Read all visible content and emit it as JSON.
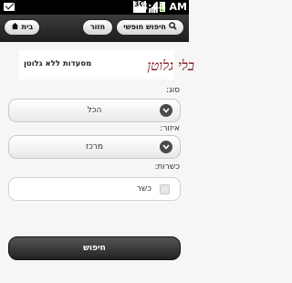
{
  "status_bar": {
    "network": "3G",
    "time": "4:44 AM",
    "icons": [
      "mail-icon",
      "network-3g-icon",
      "signal-icon",
      "battery-icon"
    ]
  },
  "toolbar": {
    "home_label": "בית",
    "back_label": "חזור",
    "free_search_label": "חיפוש חופשי"
  },
  "banner": {
    "logo_text": "בלי גלוטן",
    "subtitle": "מסעדות ללא גלוטן"
  },
  "form": {
    "type_label": "סוג:",
    "type_value": "הכל",
    "area_label": "איזור:",
    "area_value": "מרכז",
    "kosher_label": "כשרות:",
    "kosher_option": "כשר",
    "kosher_checked": false,
    "submit_label": "חיפוש"
  },
  "colors": {
    "background": "#f6f6f6",
    "toolbar": "#2a2a2a",
    "battery": "#5bd100",
    "logo": "#7a1418"
  }
}
